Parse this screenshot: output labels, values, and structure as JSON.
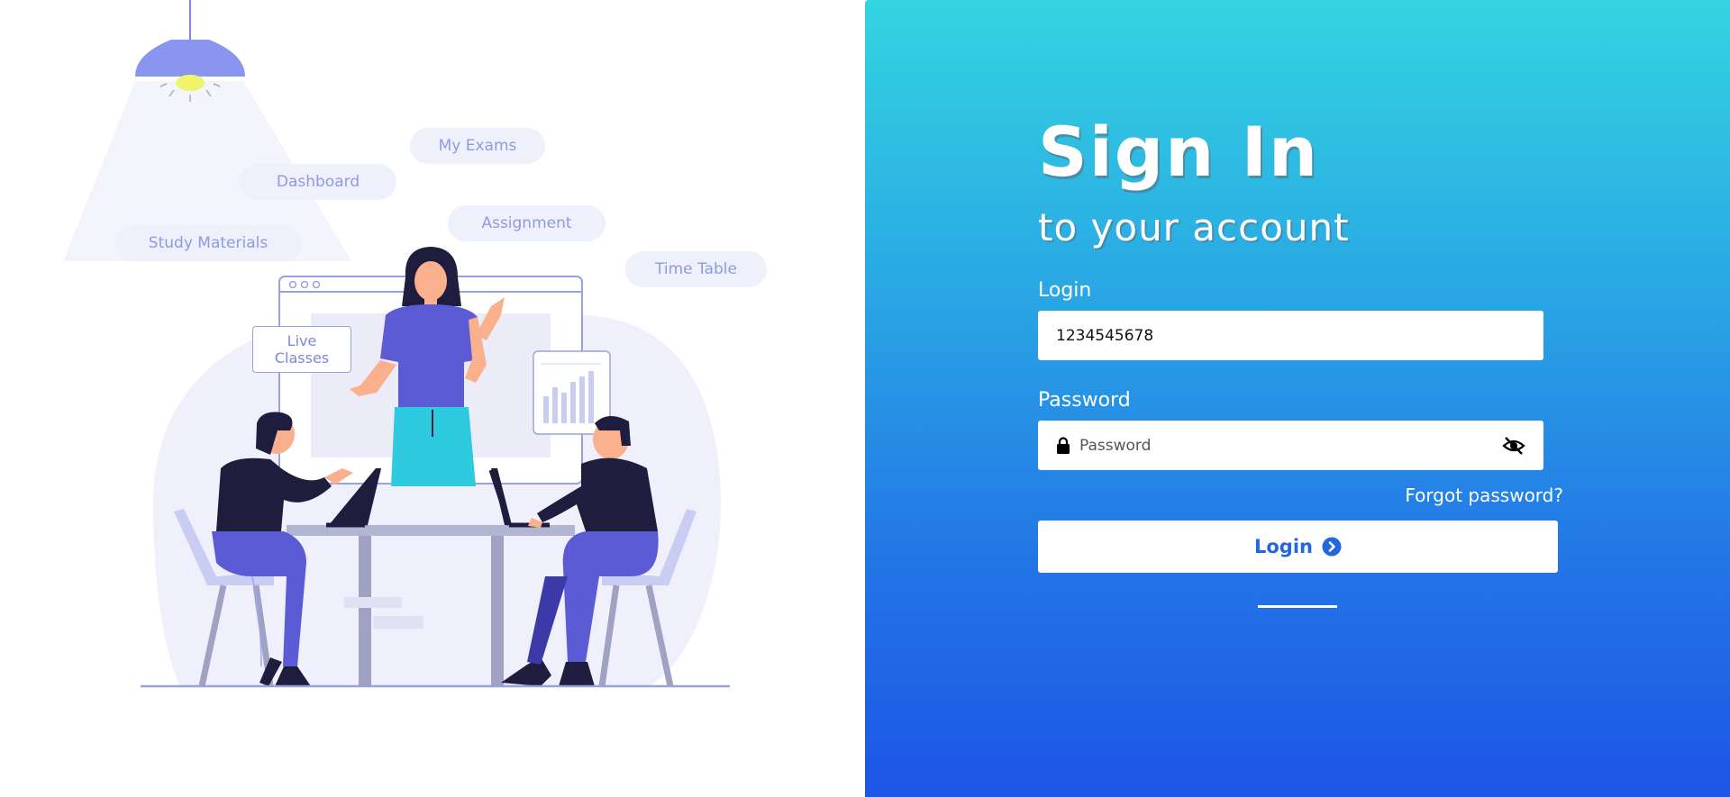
{
  "illustration": {
    "bubbles": {
      "my_exams": "My Exams",
      "dashboard": "Dashboard",
      "assignment": "Assignment",
      "study_materials": "Study Materials",
      "time_table": "Time Table"
    },
    "live_classes_line1": "Live",
    "live_classes_line2": "Classes"
  },
  "signin": {
    "title": "Sign In",
    "subtitle": "to your account",
    "login_label": "Login",
    "login_value": "1234545678",
    "password_label": "Password",
    "password_placeholder": "Password",
    "forgot_password": "Forgot password?",
    "login_button": "Login"
  },
  "colors": {
    "panel_top": "#33d4e0",
    "panel_bottom": "#1d55e6",
    "button_text": "#2268dc",
    "illustration_accent": "#5b5bd6",
    "bubble_text": "#8e9be0"
  },
  "icons": {
    "lamp": "lamp-icon",
    "lock": "lock-icon",
    "eye": "eye-slash-icon",
    "button": "chevron-right-circle-icon"
  }
}
